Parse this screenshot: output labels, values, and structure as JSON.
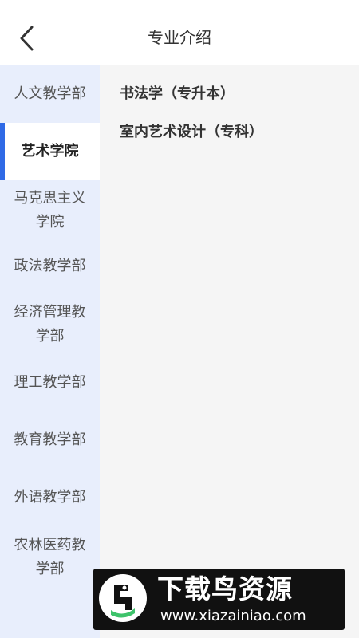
{
  "header": {
    "title": "专业介绍",
    "back_icon": "chevron-left-icon"
  },
  "sidebar": {
    "active_index": 1,
    "accent_color": "#2f6ae6",
    "items": [
      {
        "label": "人文教学部"
      },
      {
        "label": "艺术学院"
      },
      {
        "label": "马克思主义学院"
      },
      {
        "label": "政法教学部"
      },
      {
        "label": "经济管理教学部"
      },
      {
        "label": "理工教学部"
      },
      {
        "label": "教育教学部"
      },
      {
        "label": "外语教学部"
      },
      {
        "label": "农林医药教学部"
      }
    ]
  },
  "majors": [
    {
      "label": "书法学（专升本）"
    },
    {
      "label": "室内艺术设计（专科）"
    }
  ],
  "watermark": {
    "title": "下载鸟资源",
    "url": "www.xiazainiao.com"
  }
}
